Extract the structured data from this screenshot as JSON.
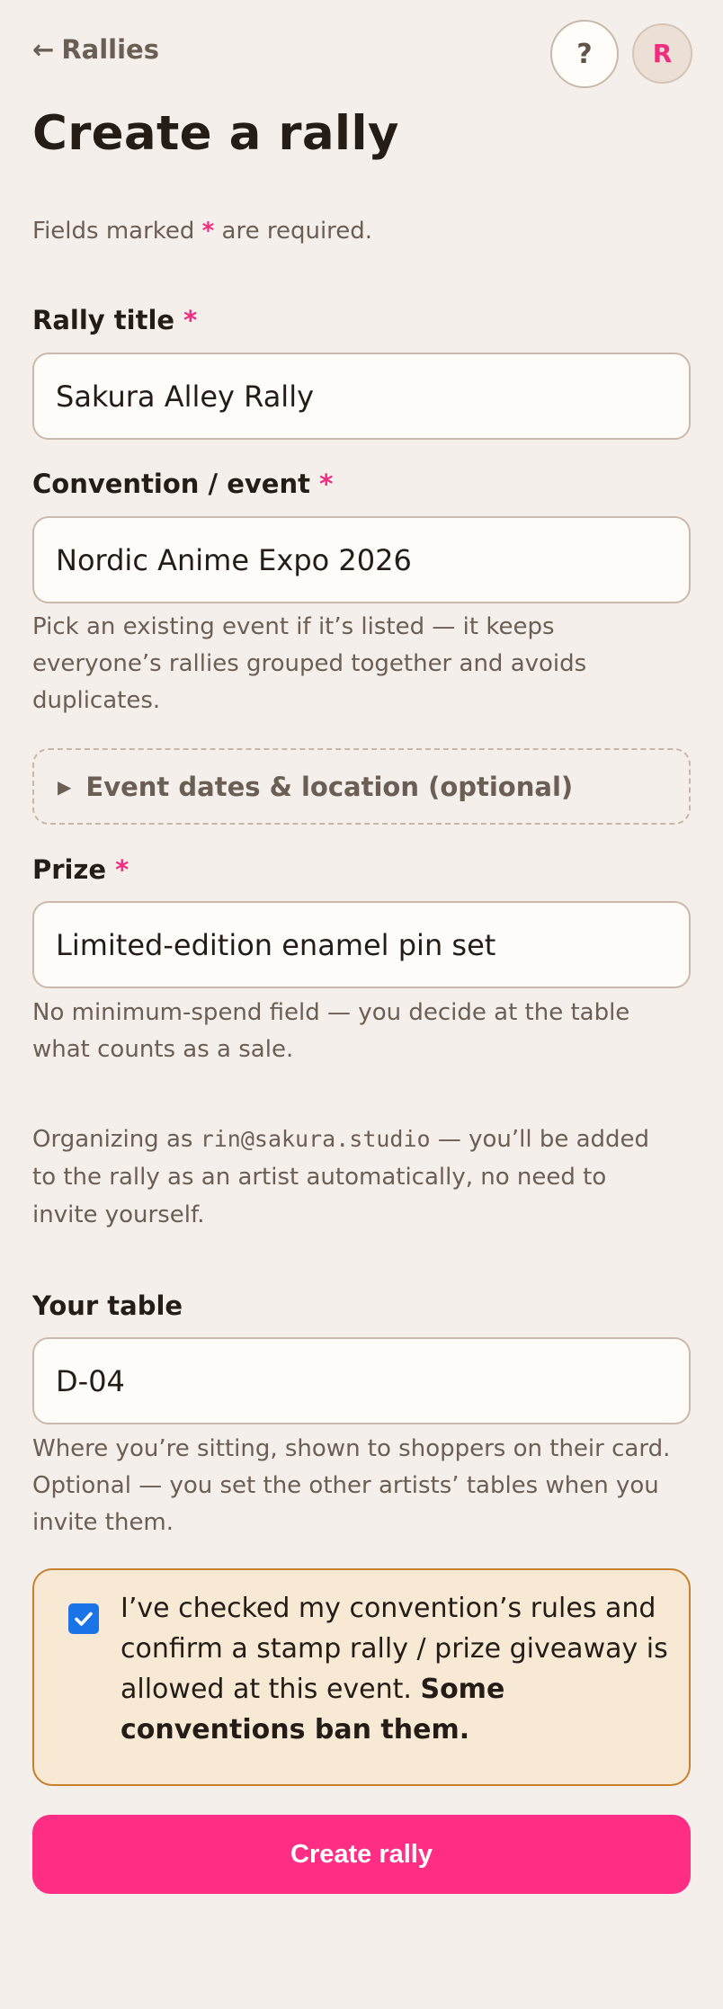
{
  "nav": {
    "back_arrow": "←",
    "back_label": "Rallies",
    "help_label": "?",
    "avatar_initial": "R"
  },
  "page": {
    "title": "Create a rally",
    "required_note_before": "Fields marked ",
    "required_star": "*",
    "required_note_after": " are required."
  },
  "fields": {
    "rally_title": {
      "label": "Rally title",
      "value": "Sakura Alley Rally"
    },
    "convention": {
      "label": "Convention / event",
      "value": "Nordic Anime Expo 2026",
      "help_lines": [
        "Pick an existing event if it’s listed — it keeps",
        "everyone’s rallies grouped together and avoids",
        "duplicates."
      ]
    },
    "event_details": {
      "label": "Event dates & location (optional)",
      "icon": "disclosure-triangle-icon"
    },
    "prize": {
      "label": "Prize",
      "value": "Limited-edition enamel pin set",
      "help_lines": [
        "No minimum-spend field — you decide at the table",
        "what counts as a sale."
      ]
    },
    "organizer": {
      "text_before": "Organizing as ",
      "email": "rin@sakura.studio",
      "text_after": " — you’ll be added",
      "lines": [
        "to the rally as an artist automatically, no need to",
        "invite yourself."
      ]
    },
    "table": {
      "label": "Your table",
      "value": "D-04",
      "help_lines": [
        "Where you’re sitting, shown to shoppers on their card.",
        "Optional — you set the other artists’ tables when you",
        "invite them."
      ]
    }
  },
  "confirm": {
    "checked": true,
    "text": "I’ve checked my convention’s rules and confirm a stamp rally / prize giveaway is allowed at this event.",
    "bold_text": "Some conventions ban them."
  },
  "submit_label": "Create rally",
  "colors": {
    "background": "#f4efea",
    "accent": "#ff2d83",
    "required_star": "#ee2d7f",
    "checkbox": "#1b73e8",
    "warning_border": "#c7812e",
    "warning_bg": "#f8e9d4"
  }
}
